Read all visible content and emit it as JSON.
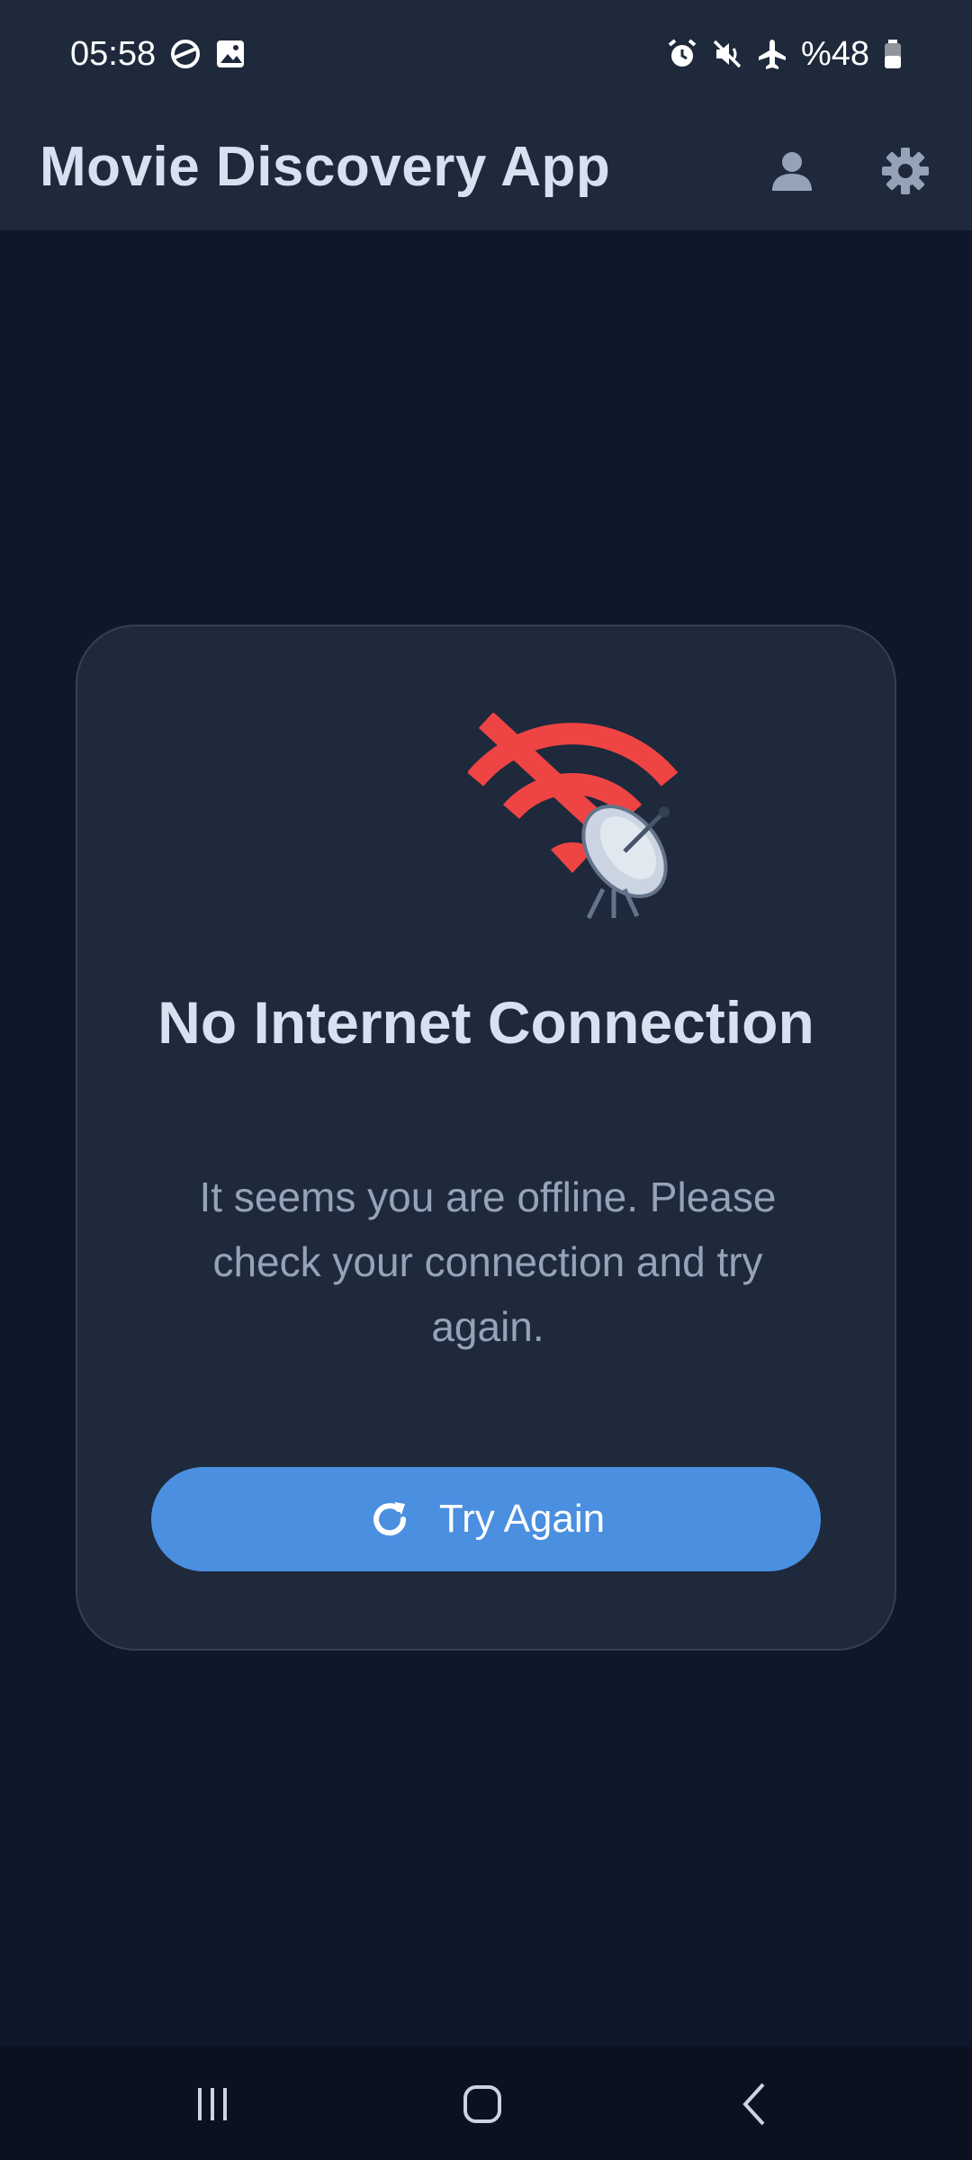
{
  "status_bar": {
    "time": "05:58",
    "battery_text": "%48",
    "left_icons": [
      "data-saver-icon",
      "gallery-icon"
    ],
    "right_icons": [
      "alarm-icon",
      "mute-icon",
      "airplane-icon",
      "battery-icon"
    ]
  },
  "app_bar": {
    "title": "Movie Discovery App",
    "icons": [
      "profile-icon",
      "settings-icon"
    ]
  },
  "offline_card": {
    "illustration": [
      "wifi-off-icon",
      "satellite-dish-icon"
    ],
    "title": "No Internet Connection",
    "message": "It seems you are offline. Please check your connection and try again.",
    "retry_label": "Try Again",
    "retry_icon": "refresh-icon"
  },
  "nav_bar": {
    "icons": [
      "recent-apps-icon",
      "home-icon",
      "back-icon"
    ]
  },
  "colors": {
    "background": "#0f172a",
    "surface": "#1e293b",
    "accent": "#4a8fe0",
    "error": "#ef4444",
    "title_text": "#d7e1ef",
    "body_text": "#94a3b8"
  }
}
